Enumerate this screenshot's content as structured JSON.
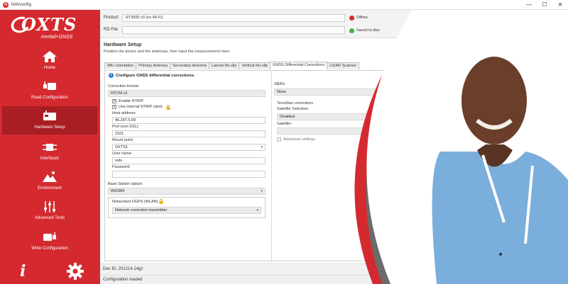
{
  "window": {
    "title": "NAVconfig",
    "app_icon": "navconfig-icon",
    "minimize": "—",
    "maximize": "☐",
    "close": "✕"
  },
  "sidebar": {
    "brand": "OXTS",
    "tagline": "inertial+GNSS",
    "items": [
      {
        "label": "Home",
        "icon": "home-icon"
      },
      {
        "label": "Read Configuration",
        "icon": "read-configuration-icon"
      },
      {
        "label": "Hardware Setup",
        "icon": "hardware-setup-icon",
        "active": true
      },
      {
        "label": "Interfaces",
        "icon": "interfaces-icon"
      },
      {
        "label": "Environment",
        "icon": "environment-icon"
      },
      {
        "label": "Advanced Tools",
        "icon": "advanced-tools-icon"
      },
      {
        "label": "Write Configuration",
        "icon": "write-configuration-icon"
      }
    ],
    "info_glyph": "i"
  },
  "product_bar": {
    "product_label": "Product",
    "product_value": "RT3000 v3 (no Wi-Fi)",
    "rd_label": "RD File",
    "rd_value": "",
    "status_offline": "Offline",
    "status_saved": "Saved to disc"
  },
  "page": {
    "title": "Hardware Setup",
    "subtitle": "Position the device and the antennas, then input the measurements here."
  },
  "tabs": [
    "IMU orientation",
    "Primary Antenna",
    "Secondary Antenna",
    "Lateral No-slip",
    "Vertical No-slip",
    "GNSS Differential Corrections",
    "LiDAR Scanner"
  ],
  "active_tab": 5,
  "gnss": {
    "banner": "Configure GNSS differential corrections.",
    "correction_format_label": "Correction format:",
    "correction_format_value": "RTCM v3",
    "enable_ntrip_label": "Enable NTRIP",
    "enable_ntrip_checked": true,
    "internal_ntrip_label": "Use internal NTRIP client",
    "internal_ntrip_checked": true,
    "host_label": "Host address:",
    "host_value": "46.247.5.99",
    "port_label": "Port (non SSL):",
    "port_value": "2101",
    "mount_label": "Mount point:",
    "mount_value": "OXTS1",
    "user_label": "User name:",
    "user_value": "oxts",
    "password_label": "Password:",
    "password_value": "",
    "datum_label": "Base Station datum:",
    "datum_value": "WGS84",
    "dgps_label": "Networked DGPS (WLAN)",
    "dgps_value": "Network correction transmitter",
    "sbas_label": "SBAS:",
    "sbas_value": "None",
    "terrastar_label": "TerraStar corrections",
    "sat_selection_label": "Satellite Selection:",
    "sat_selection_value": "Disabled",
    "satellite_label": "Satellite:",
    "satellite_value": "",
    "advanced_label": "Advanced settings"
  },
  "dev_id": "Dev ID: 201214.14gz",
  "status": "Configuration loaded",
  "colors": {
    "brand_red": "#d42a2f",
    "active_red": "#a81e22",
    "overlay_grey": "#6b6b6b",
    "shirt_blue": "#7aaedb"
  }
}
